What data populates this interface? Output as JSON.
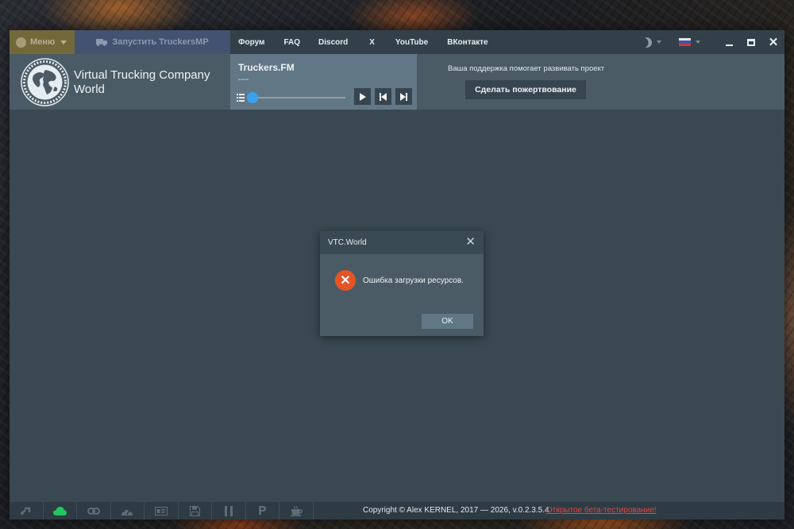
{
  "topbar": {
    "menu_label": "Меню",
    "launch_label": "Запустить TruckersMP",
    "nav": [
      "Форум",
      "FAQ",
      "Discord",
      "X",
      "YouTube",
      "ВКонтакте"
    ]
  },
  "header": {
    "brand_line1": "Virtual Trucking Company",
    "brand_line2": "World",
    "radio_title": "Truckers.FM",
    "radio_subtitle": "----",
    "volume_level": 0.0,
    "support_text": "Ваша поддержка помогает развивать проект",
    "donate_label": "Сделать пожертвование"
  },
  "dialog": {
    "title": "VTC.World",
    "message": "Ошибка загрузки ресурсов.",
    "ok_label": "OK",
    "icon": "error-icon"
  },
  "statusbar": {
    "icons": [
      "link-icon",
      "cloud-icon",
      "chain-icon",
      "speedometer-icon",
      "id-card-icon",
      "save-icon",
      "pause-icon",
      "parking-icon",
      "cup-icon"
    ],
    "cloud_status_color": "#22c55e",
    "copyright": "Copyright © Alex KERNEL, 2017 — 2026, v.0.2.3.5.4",
    "beta_link": "Открытое бета-тестирование!"
  },
  "colors": {
    "accent_blue": "#3aa1ef",
    "error_orange": "#e45425",
    "beta_red": "#e04646"
  }
}
